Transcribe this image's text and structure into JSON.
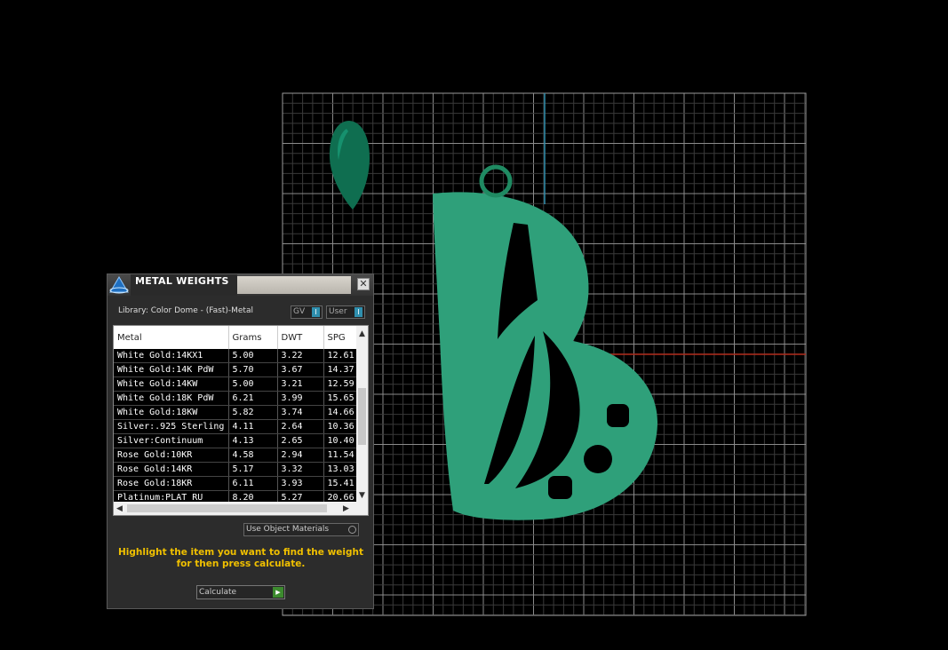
{
  "panel": {
    "title": "METAL WEIGHTS",
    "close_symbol": "✕",
    "library_label": "Library: Color Dome - (Fast)-Metal",
    "toggle_gv": "GV",
    "toggle_user": "User",
    "toggle_knob": "I",
    "use_materials_label": "Use Object Materials",
    "instructions": "Highlight the item you want to find the weight for then press calculate.",
    "calculate_label": "Calculate",
    "calculate_icon": "▶",
    "scroll_up": "▲",
    "scroll_down": "▼",
    "scroll_left": "◀",
    "scroll_right": "▶"
  },
  "table": {
    "columns": [
      "Metal",
      "Grams",
      "DWT",
      "SPG"
    ],
    "rows": [
      [
        "White Gold:14KX1",
        "5.00",
        "3.22",
        "12.61"
      ],
      [
        "White Gold:14K PdW",
        "5.70",
        "3.67",
        "14.37"
      ],
      [
        "White Gold:14KW",
        "5.00",
        "3.21",
        "12.59"
      ],
      [
        "White Gold:18K PdW",
        "6.21",
        "3.99",
        "15.65"
      ],
      [
        "White Gold:18KW",
        "5.82",
        "3.74",
        "14.66"
      ],
      [
        "Silver:.925 Sterling",
        "4.11",
        "2.64",
        "10.36"
      ],
      [
        "Silver:Continuum",
        "4.13",
        "2.65",
        "10.40"
      ],
      [
        "Rose Gold:10KR",
        "4.58",
        "2.94",
        "11.54"
      ],
      [
        "Rose Gold:14KR",
        "5.17",
        "3.32",
        "13.03"
      ],
      [
        "Rose Gold:18KR",
        "6.11",
        "3.93",
        "15.41"
      ],
      [
        "Platinum:PLAT RU",
        "8.20",
        "5.27",
        "20.66"
      ]
    ]
  },
  "colors": {
    "model": "#2fa07a",
    "gem": "#0f6e50",
    "grid": "#6e6e6e",
    "axis_x": "#b02a1a",
    "axis_y": "#2f8fae",
    "instruction_text": "#f0c000"
  },
  "icons": {
    "app_logo": "pyramid-logo-icon",
    "close": "close-icon",
    "calculate": "play-arrow-icon"
  }
}
